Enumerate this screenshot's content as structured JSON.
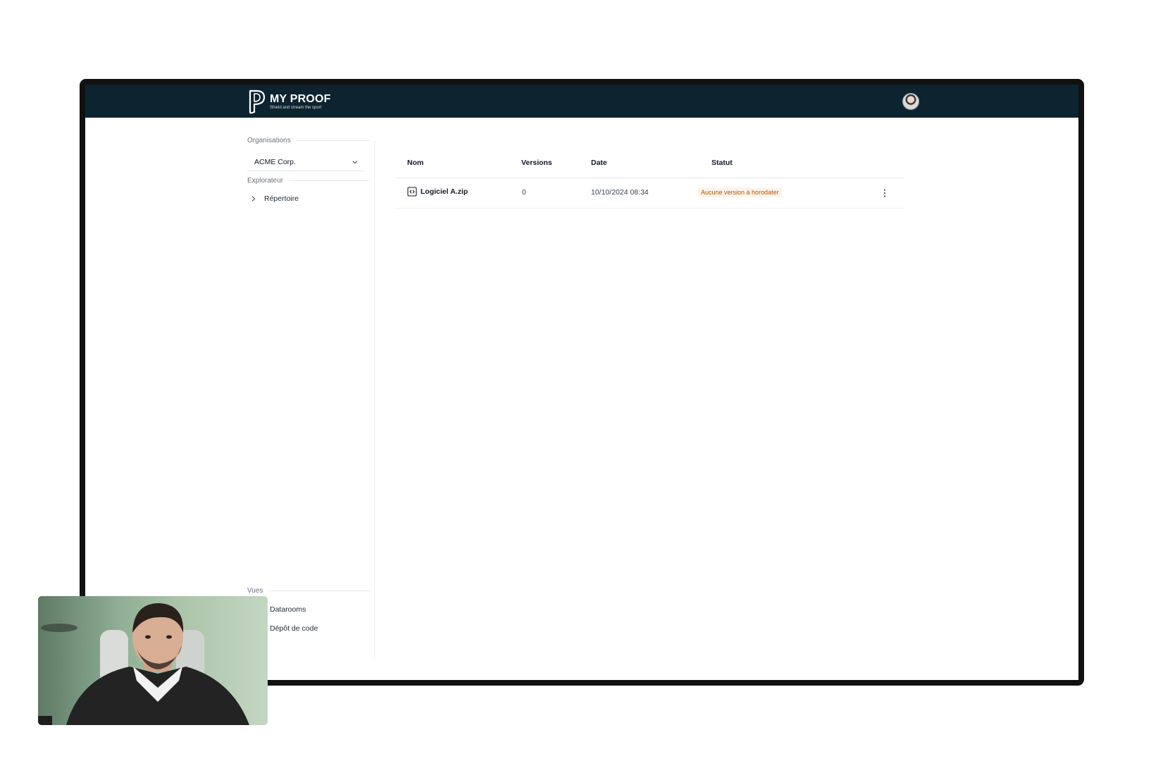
{
  "app": {
    "brand_title": "MY PROOF",
    "brand_tagline": "Shield and stream the sport"
  },
  "sidebar": {
    "organisations_label": "Organisations",
    "selected_org": "ACME Corp.",
    "explorer_label": "Explorateur",
    "tree_item": "Répertoire",
    "views_label": "Vues",
    "views": [
      {
        "label": "Datarooms",
        "icon": "database-icon"
      },
      {
        "label": "Dépôt de code",
        "icon": "code-file-icon"
      }
    ]
  },
  "table": {
    "headers": {
      "name": "Nom",
      "versions": "Versions",
      "date": "Date",
      "status": "Statut"
    },
    "rows": [
      {
        "name": "Logiciel A.zip",
        "versions": "0",
        "date": "10/10/2024 08:34",
        "status": "Aucune version à horodater"
      }
    ]
  },
  "colors": {
    "topbar": "#0d2430",
    "status_badge_bg": "#fdf4ea",
    "status_badge_text": "#b45309"
  }
}
